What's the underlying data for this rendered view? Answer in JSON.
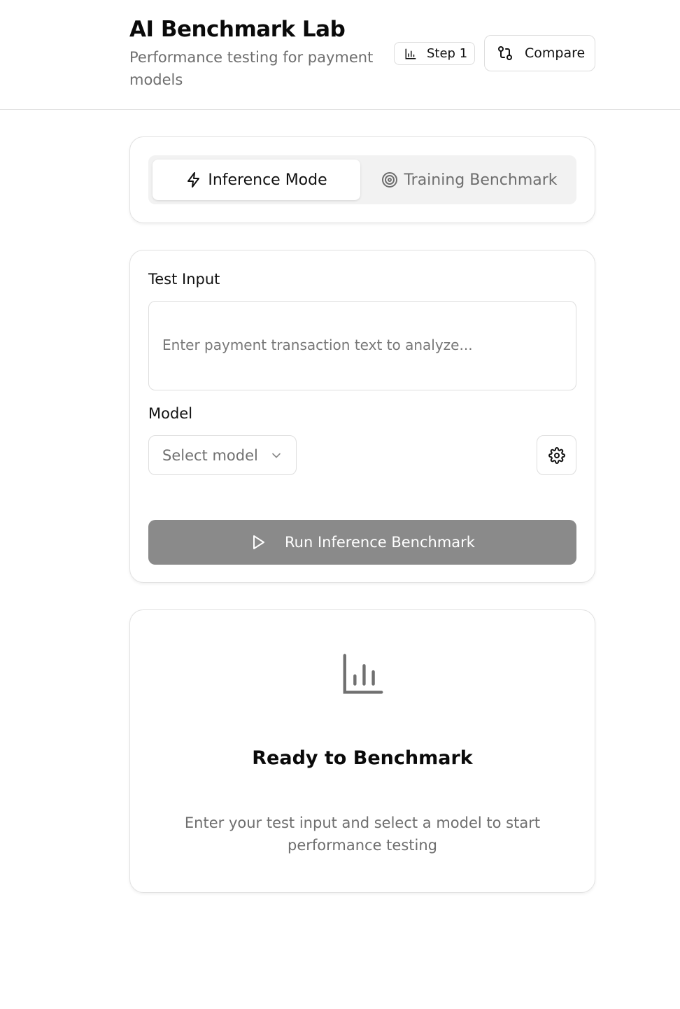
{
  "header": {
    "title": "AI Benchmark Lab",
    "subtitle": "Performance testing for payment models",
    "step_label": "Step 1",
    "step_icon": "bar-chart-icon",
    "compare_label": "Compare",
    "compare_icon": "git-compare-icon"
  },
  "mode_tabs": [
    {
      "label": "Inference Mode",
      "icon": "zap-icon",
      "active": true
    },
    {
      "label": "Training Benchmark",
      "icon": "target-icon",
      "active": false
    }
  ],
  "form": {
    "input_label": "Test Input",
    "input_placeholder": "Enter payment transaction text to analyze...",
    "input_value": "",
    "model_label": "Model",
    "model_placeholder": "Select model",
    "settings_icon": "gear-icon",
    "run_label": "Run Inference Benchmark",
    "run_icon": "play-icon"
  },
  "empty_state": {
    "icon": "bar-chart-icon",
    "title": "Ready to Benchmark",
    "text": "Enter your test input and select a model to start performance testing"
  },
  "colors": {
    "run_button_disabled": "#8a8a8a",
    "muted_text": "#6e6e6e",
    "border": "#e2e2e2"
  }
}
